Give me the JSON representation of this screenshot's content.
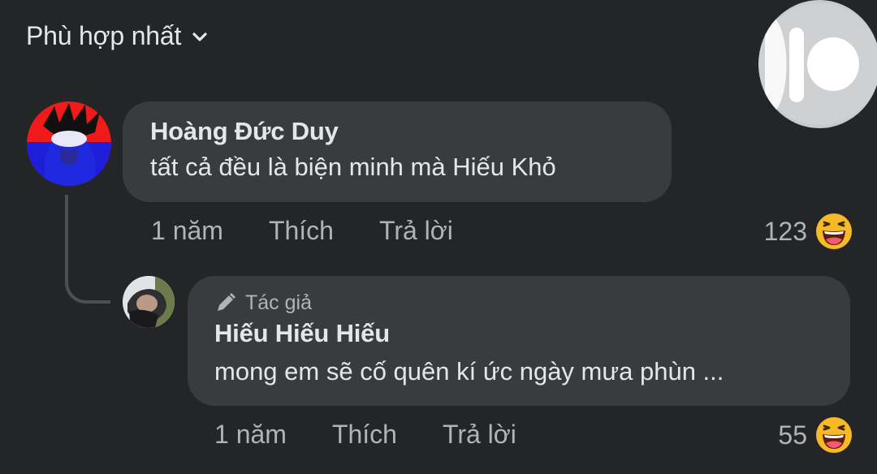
{
  "sort": {
    "label": "Phù hợp nhất",
    "icon": "chevron-down-icon"
  },
  "comments": [
    {
      "author": "Hoàng Đức Duy",
      "text": "tất cả đều là biện minh mà Hiếu Khỏ",
      "time": "1 năm",
      "like_label": "Thích",
      "reply_label": "Trả lời",
      "reaction_count": "123",
      "reaction_icon": "haha-emoji-icon"
    }
  ],
  "replies": [
    {
      "badge": "Tác giả",
      "badge_icon": "pen-icon",
      "author": "Hiếu Hiếu Hiếu",
      "text": "mong em sẽ cố quên kí ức ngày mưa phùn ...",
      "time": "1 năm",
      "like_label": "Thích",
      "reply_label": "Trả lời",
      "reaction_count": "55",
      "reaction_icon": "haha-emoji-icon"
    }
  ],
  "colors": {
    "background": "#242526",
    "bubble": "#3a3b3c",
    "primary_text": "#e4e6eb",
    "secondary_text": "#b0b3b8",
    "emoji_yellow": "#f7b928"
  }
}
